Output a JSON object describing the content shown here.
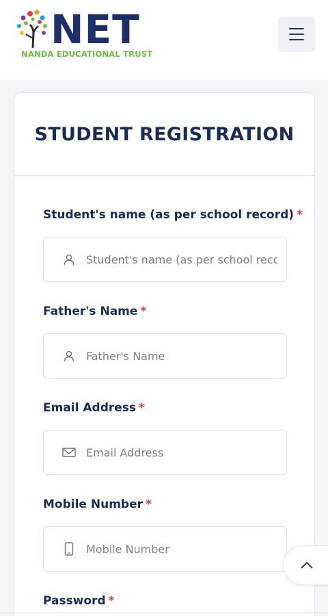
{
  "header": {
    "logo_text": "NET",
    "logo_subtitle": "NANDA EDUCATIONAL TRUST",
    "menu_icon": "hamburger-menu-icon"
  },
  "form": {
    "title": "STUDENT REGISTRATION",
    "required_mark": "*",
    "fields": [
      {
        "label": "Student's name (as per school record)",
        "placeholder": "Student's name (as per school record)",
        "value": "",
        "icon": "user-icon"
      },
      {
        "label": "Father's Name",
        "placeholder": "Father's Name",
        "value": "",
        "icon": "user-icon"
      },
      {
        "label": "Email Address",
        "placeholder": "Email Address",
        "value": "",
        "icon": "envelope-icon"
      },
      {
        "label": "Mobile Number",
        "placeholder": "Mobile Number",
        "value": "",
        "icon": "mobile-phone-icon"
      },
      {
        "label": "Password",
        "placeholder": "",
        "value": "",
        "icon": ""
      }
    ]
  },
  "scroll_top_icon": "chevron-up-icon",
  "colors": {
    "brand_navy": "#1f2f6b",
    "brand_green": "#6dbd3e",
    "required_red": "#e23d3d",
    "label_text": "#1b2c56"
  }
}
